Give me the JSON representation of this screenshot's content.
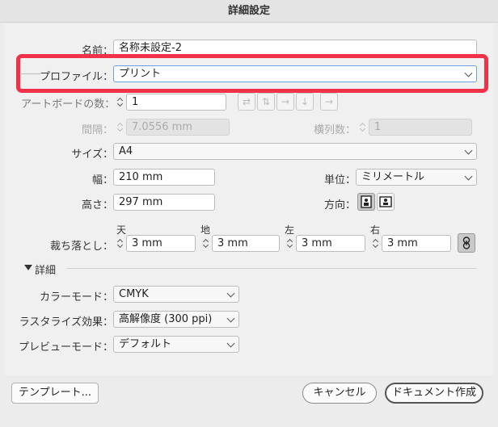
{
  "window": {
    "title": "詳細設定"
  },
  "form": {
    "name_label": "名前：",
    "name_value": "名称未設定-2",
    "profile_label": "プロファイル：",
    "profile_value": "プリント",
    "artboards_label": "アートボードの数：",
    "artboards_value": "1",
    "spacing_label": "間隔：",
    "spacing_value": "7.0556 mm",
    "columns_label": "横列数：",
    "columns_value": "1",
    "size_label": "サイズ：",
    "size_value": "A4",
    "width_label": "幅：",
    "width_value": "210 mm",
    "units_label": "単位：",
    "units_value": "ミリメートル",
    "height_label": "高さ：",
    "height_value": "297 mm",
    "orientation_label": "方向：",
    "bleed_label": "裁ち落とし：",
    "bleed": {
      "top_label": "天",
      "top_value": "3 mm",
      "bottom_label": "地",
      "bottom_value": "3 mm",
      "left_label": "左",
      "left_value": "3 mm",
      "right_label": "右",
      "right_value": "3 mm"
    }
  },
  "advanced": {
    "header": "詳細",
    "color_mode_label": "カラーモード：",
    "color_mode_value": "CMYK",
    "raster_label": "ラスタライズ効果：",
    "raster_value": "高解像度 (300 ppi)",
    "preview_label": "プレビューモード：",
    "preview_value": "デフォルト"
  },
  "buttons": {
    "templates": "テンプレート...",
    "cancel": "キャンセル",
    "create": "ドキュメント作成"
  },
  "colors": {
    "highlight": "#f0314a"
  }
}
